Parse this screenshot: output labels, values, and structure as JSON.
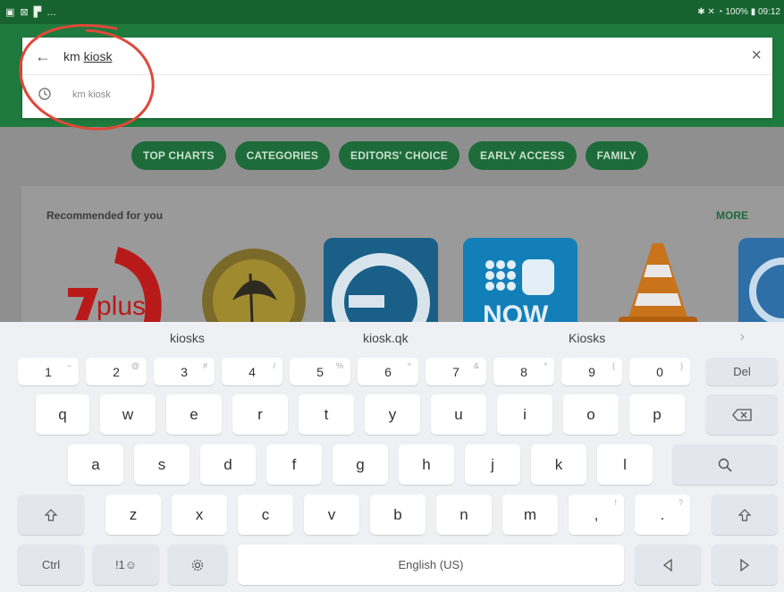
{
  "status": {
    "left_icons": [
      "image-icon",
      "notification-icon",
      "flag-icon",
      "ellipsis"
    ],
    "right": "✱ ✕ ◔ 100% ▮ 09:12"
  },
  "search": {
    "query_plain": "km ",
    "query_underlined": "kiosk",
    "suggestion": "km kiosk",
    "back_symbol": "←",
    "clear_symbol": "×"
  },
  "chips": [
    "TOP CHARTS",
    "CATEGORIES",
    "EDITORS' CHOICE",
    "EARLY ACCESS",
    "FAMILY"
  ],
  "recommended": {
    "title": "Recommended for you",
    "more": "MORE",
    "apps": [
      "7plus",
      "National Parks",
      "Speech",
      "9NOW",
      "VLC",
      "Edge"
    ],
    "plus_text": "plus",
    "nine_text": "NOW"
  },
  "keyboard": {
    "predictions": [
      "kiosks",
      "kiosk.qk",
      "Kiosks"
    ],
    "pred_arrow": "›",
    "number_row": [
      {
        "k": "1",
        "s": "~"
      },
      {
        "k": "2",
        "s": "@"
      },
      {
        "k": "3",
        "s": "#"
      },
      {
        "k": "4",
        "s": "/"
      },
      {
        "k": "5",
        "s": "%"
      },
      {
        "k": "6",
        "s": "^"
      },
      {
        "k": "7",
        "s": "&"
      },
      {
        "k": "8",
        "s": "*"
      },
      {
        "k": "9",
        "s": "("
      },
      {
        "k": "0",
        "s": ")"
      }
    ],
    "del": "Del",
    "row_q": [
      "q",
      "w",
      "e",
      "r",
      "t",
      "y",
      "u",
      "i",
      "o",
      "p"
    ],
    "row_a": [
      "a",
      "s",
      "d",
      "f",
      "g",
      "h",
      "j",
      "k",
      "l"
    ],
    "row_z": [
      "z",
      "x",
      "c",
      "v",
      "b",
      "n",
      "m"
    ],
    "comma": {
      "k": ",",
      "s": "!"
    },
    "period": {
      "k": ".",
      "s": "?"
    },
    "ctrl": "Ctrl",
    "symbols": "!1☺",
    "space": "English (US)"
  },
  "colors": {
    "status_bar": "#17632f",
    "header": "#1f7a3d",
    "chip": "#1d6b39",
    "annotation": "#e0483a"
  }
}
